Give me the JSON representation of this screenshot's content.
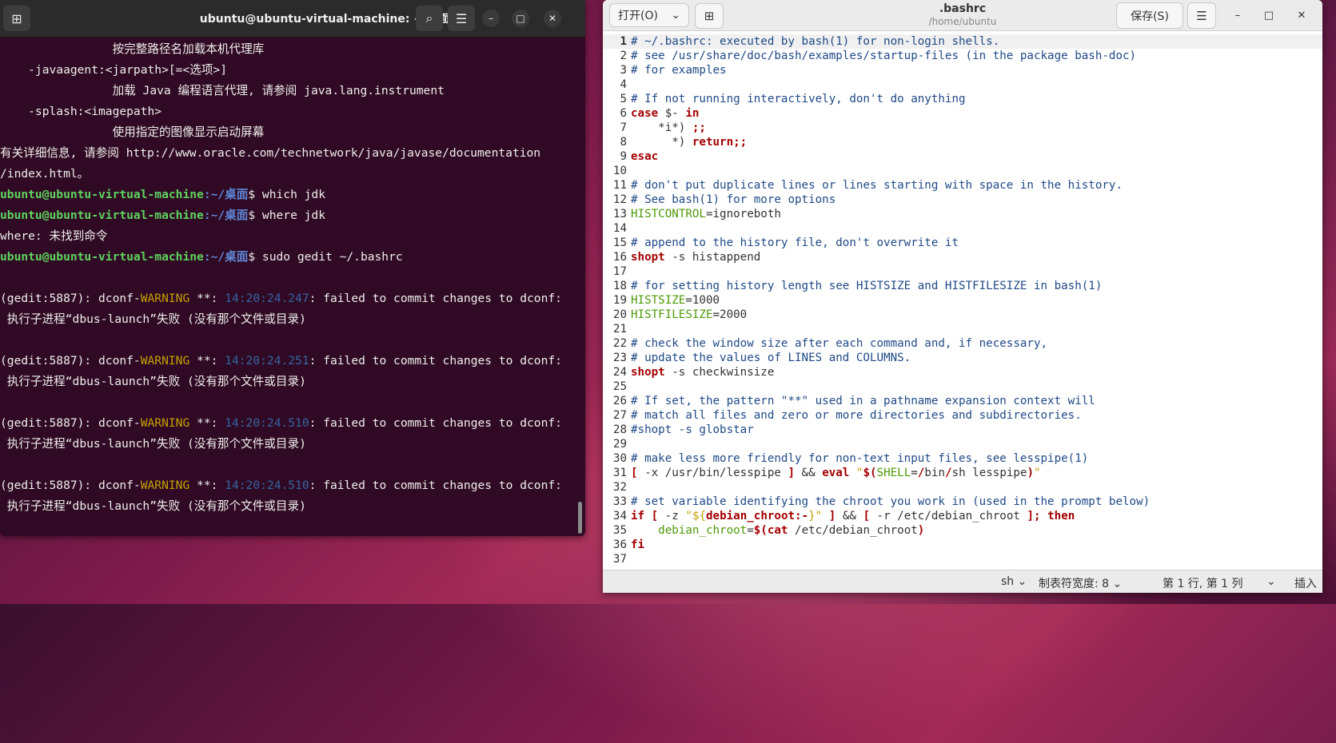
{
  "terminal": {
    "title": "ubuntu@ubuntu-virtual-machine: ~/桌面",
    "lines": [
      {
        "text": "                按完整路径名加载本机代理库"
      },
      {
        "text": "    -javaagent:<jarpath>[=<选项>]"
      },
      {
        "text": "                加载 Java 编程语言代理, 请参阅 java.lang.instrument"
      },
      {
        "text": "    -splash:<imagepath>"
      },
      {
        "text": "                使用指定的图像显示启动屏幕"
      },
      {
        "text": "有关详细信息, 请参阅 http://www.oracle.com/technetwork/java/javase/documentation"
      },
      {
        "text": "/index.html。"
      },
      {
        "user": "ubuntu@ubuntu-virtual-machine",
        "path": ":~/桌面",
        "cmd": "$ which jdk"
      },
      {
        "user": "ubuntu@ubuntu-virtual-machine",
        "path": ":~/桌面",
        "cmd": "$ where jdk"
      },
      {
        "text": "where: 未找到命令"
      },
      {
        "user": "ubuntu@ubuntu-virtual-machine",
        "path": ":~/桌面",
        "cmd": "$ sudo gedit ~/.bashrc"
      },
      {
        "text": ""
      },
      {
        "pre": "(gedit:5887): dconf-",
        "warn": "WARNING",
        "mid": " **: ",
        "time": "14:20:24.247",
        "post": ": failed to commit changes to dconf:"
      },
      {
        "text": " 执行子进程“dbus-launch”失败 (没有那个文件或目录)"
      },
      {
        "text": ""
      },
      {
        "pre": "(gedit:5887): dconf-",
        "warn": "WARNING",
        "mid": " **: ",
        "time": "14:20:24.251",
        "post": ": failed to commit changes to dconf:"
      },
      {
        "text": " 执行子进程“dbus-launch”失败 (没有那个文件或目录)"
      },
      {
        "text": ""
      },
      {
        "pre": "(gedit:5887): dconf-",
        "warn": "WARNING",
        "mid": " **: ",
        "time": "14:20:24.510",
        "post": ": failed to commit changes to dconf:"
      },
      {
        "text": " 执行子进程“dbus-launch”失败 (没有那个文件或目录)"
      },
      {
        "text": ""
      },
      {
        "pre": "(gedit:5887): dconf-",
        "warn": "WARNING",
        "mid": " **: ",
        "time": "14:20:24.510",
        "post": ": failed to commit changes to dconf:"
      },
      {
        "text": " 执行子进程“dbus-launch”失败 (没有那个文件或目录)"
      }
    ]
  },
  "editor": {
    "open_label": "打开(O)",
    "title": ".bashrc",
    "subtitle": "/home/ubuntu",
    "save_label": "保存(S)",
    "lines": [
      [
        [
          "c",
          "# ~/.bashrc: executed by bash(1) for non-login shells."
        ]
      ],
      [
        [
          "c",
          "# see /usr/share/doc/bash/examples/startup-files (in the package bash-doc)"
        ]
      ],
      [
        [
          "c",
          "# for examples"
        ]
      ],
      [],
      [
        [
          "c",
          "# If not running interactively, don't do anything"
        ]
      ],
      [
        [
          "k",
          "case"
        ],
        [
          "o",
          " $- "
        ],
        [
          "k",
          "in"
        ]
      ],
      [
        [
          "o",
          "    *i*) "
        ],
        [
          "k",
          ";;"
        ]
      ],
      [
        [
          "o",
          "      *) "
        ],
        [
          "k",
          "return;;"
        ]
      ],
      [
        [
          "k",
          "esac"
        ]
      ],
      [],
      [
        [
          "c",
          "# don't put duplicate lines or lines starting with space in the history."
        ]
      ],
      [
        [
          "c",
          "# See bash(1) for more options"
        ]
      ],
      [
        [
          "v",
          "HISTCONTROL"
        ],
        [
          "o",
          "=ignoreboth"
        ]
      ],
      [],
      [
        [
          "c",
          "# append to the history file, don't overwrite it"
        ]
      ],
      [
        [
          "k",
          "shopt"
        ],
        [
          "o",
          " -s histappend"
        ]
      ],
      [],
      [
        [
          "c",
          "# for setting history length see HISTSIZE and HISTFILESIZE in bash(1)"
        ]
      ],
      [
        [
          "v",
          "HISTSIZE"
        ],
        [
          "o",
          "=1000"
        ]
      ],
      [
        [
          "v",
          "HISTFILESIZE"
        ],
        [
          "o",
          "=2000"
        ]
      ],
      [],
      [
        [
          "c",
          "# check the window size after each command and, if necessary,"
        ]
      ],
      [
        [
          "c",
          "# update the values of LINES and COLUMNS."
        ]
      ],
      [
        [
          "k",
          "shopt"
        ],
        [
          "o",
          " -s checkwinsize"
        ]
      ],
      [],
      [
        [
          "c",
          "# If set, the pattern \"**\" used in a pathname expansion context will"
        ]
      ],
      [
        [
          "c",
          "# match all files and zero or more directories and subdirectories."
        ]
      ],
      [
        [
          "c",
          "#shopt -s globstar"
        ]
      ],
      [],
      [
        [
          "c",
          "# make less more friendly for non-text input files, see lesspipe(1)"
        ]
      ],
      [
        [
          "k",
          "["
        ],
        [
          "o",
          " -x /usr/bin/lesspipe "
        ],
        [
          "k",
          "]"
        ],
        [
          "o",
          " && "
        ],
        [
          "k",
          "eval"
        ],
        [
          "o",
          " "
        ],
        [
          "s",
          "\""
        ],
        [
          "k",
          "$("
        ],
        [
          "v",
          "SHELL"
        ],
        [
          "o",
          "="
        ],
        [
          "k",
          "/"
        ],
        [
          "o",
          "bin"
        ],
        [
          "k",
          "/"
        ],
        [
          "o",
          "sh lesspipe"
        ],
        [
          "k",
          ")"
        ],
        [
          "s",
          "\""
        ]
      ],
      [],
      [
        [
          "c",
          "# set variable identifying the chroot you work in (used in the prompt below)"
        ]
      ],
      [
        [
          "k",
          "if"
        ],
        [
          "o",
          " "
        ],
        [
          "k",
          "["
        ],
        [
          "o",
          " -z "
        ],
        [
          "s",
          "\"${"
        ],
        [
          "k",
          "debian_chroot:-"
        ],
        [
          "s",
          "}\""
        ],
        [
          "o",
          " "
        ],
        [
          "k",
          "]"
        ],
        [
          "o",
          " && "
        ],
        [
          "k",
          "["
        ],
        [
          "o",
          " -r /etc/debian_chroot "
        ],
        [
          "k",
          "]; then"
        ]
      ],
      [
        [
          "v",
          "    debian_chroot"
        ],
        [
          "o",
          "="
        ],
        [
          "k",
          "$(cat"
        ],
        [
          "o",
          " /etc/debian_chroot"
        ],
        [
          "k",
          ")"
        ]
      ],
      [
        [
          "k",
          "fi"
        ]
      ],
      []
    ],
    "status": {
      "language": "sh",
      "tab_width": "制表符宽度: 8",
      "position": "第 1 行, 第 1 列",
      "mode": "插入"
    }
  }
}
